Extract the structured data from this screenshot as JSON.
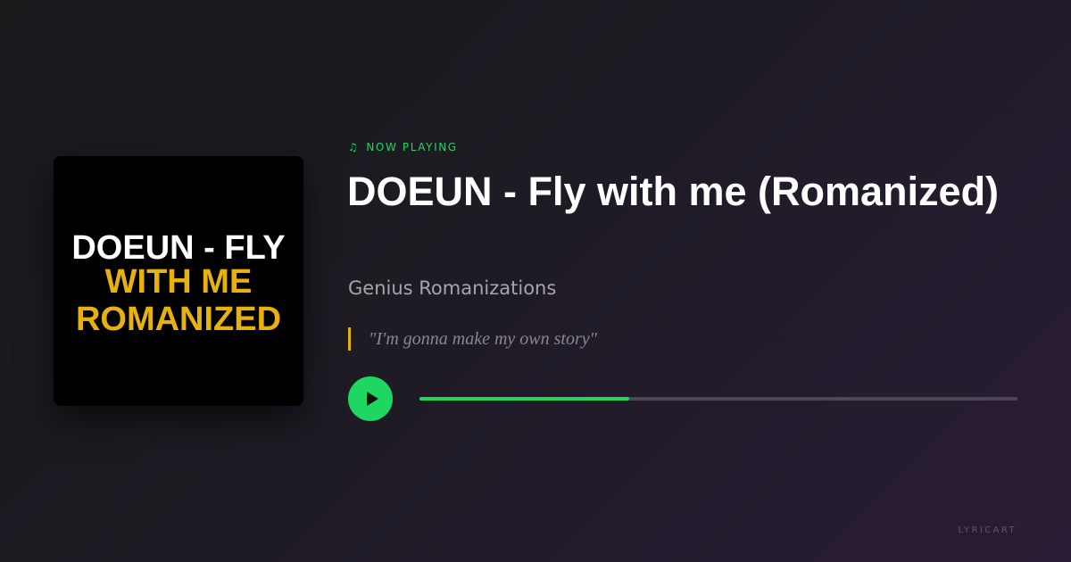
{
  "album_art": {
    "line1": "DOEUN - FLY",
    "line2": "WITH ME",
    "line3": "ROMANIZED"
  },
  "now_playing": {
    "icon": "music-note-icon",
    "label": "NOW PLAYING"
  },
  "song": {
    "title": "DOEUN - Fly with me (Romanized)",
    "artist": "Genius Romanizations",
    "lyric": "\"I'm gonna make my own story\""
  },
  "player": {
    "play_icon": "play-icon",
    "progress": 0.35
  },
  "brand": "LYRICART",
  "colors": {
    "accent": "#1ed760",
    "highlight": "#e8b20e",
    "background": "#1e1b24"
  }
}
